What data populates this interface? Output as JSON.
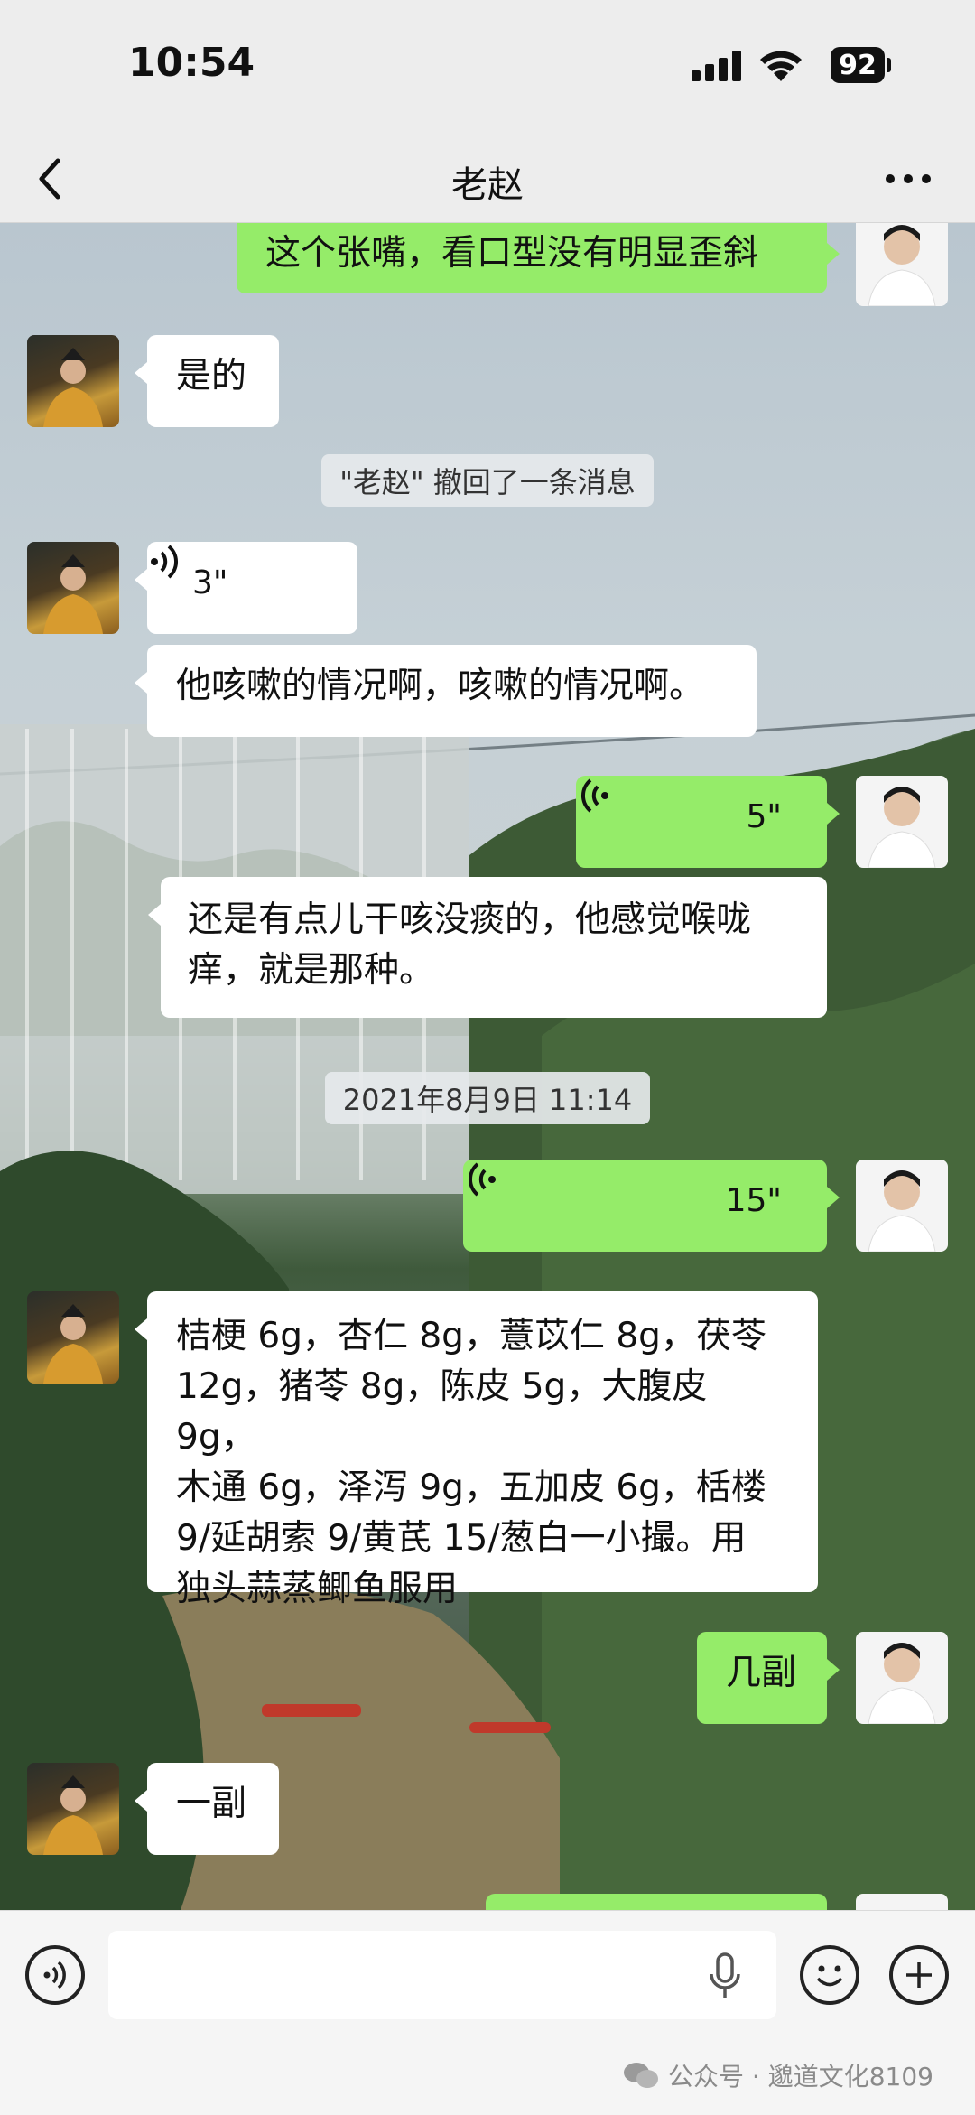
{
  "status_bar": {
    "time": "10:54",
    "battery": "92"
  },
  "nav": {
    "title": "老赵"
  },
  "messages": {
    "m1": "这个张嘴，看口型没有明显歪斜",
    "m2": "是的",
    "recall": "\"老赵\" 撤回了一条消息",
    "m3_voice": "3\"",
    "m4": "他咳嗽的情况啊，咳嗽的情况啊。",
    "m5_voice": "5\"",
    "m6_line1": "还是有点儿干咳没痰的，他感觉喉咙",
    "m6_line2": "痒，就是那种。",
    "timestamp": "2021年8月9日 11:14",
    "m7_voice": "15\"",
    "m8_line1": "桔梗 6g，杏仁 8g，薏苡仁 8g，茯苓",
    "m8_line2": "12g，猪苓 8g，陈皮 5g，大腹皮 9g，",
    "m8_line3": "木通 6g，泽泻 9g，五加皮 6g，栝楼",
    "m8_line4": "9/延胡索 9/黄芪 15/葱白一小撮。用",
    "m8_line5": "独头蒜蒸鲫鱼服用",
    "m9": "几副",
    "m10": "一副"
  },
  "watermark": "公众号 · 邈道文化8109"
}
